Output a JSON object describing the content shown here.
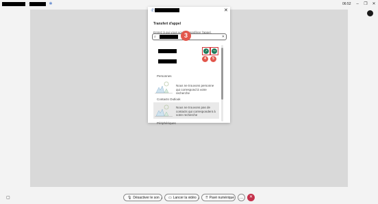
{
  "titlebar": {
    "time": "06:52",
    "pin_icon": "pin-icon",
    "minimize": "–",
    "restore": "❐",
    "close": "✕"
  },
  "dialog": {
    "title": "Transfert d'appel",
    "close": "✕",
    "subtitle": "Entrez à qui vous voulez transférer l'appel.",
    "search_icon": "⌕",
    "search_clear": "✕",
    "callout_search": "3",
    "callout_a": "4",
    "callout_b": "5",
    "sections": [
      {
        "label": "Personnes",
        "empty_text": "Nous ne trouvons personne qui correspond à votre recherche"
      },
      {
        "label": "Contacts Outlook",
        "empty_text": "Nous ne trouvons pas de contacts qui correspondent à votre recherche"
      },
      {
        "label": "Périphériques"
      }
    ],
    "result_actions": {
      "a": "↗",
      "b": "↪"
    }
  },
  "callbar": {
    "mute": "Désactiver le son",
    "video": "Lancer la vidéo",
    "dialpad": "Pavé numérique",
    "more": "…",
    "hangup": "✕",
    "mute_icon": "🎙",
    "video_icon": "▭",
    "dialpad_icon": "⠿"
  },
  "colors": {
    "accent_green": "#1f7a5a",
    "callout_red": "#e2574c",
    "hangup_red": "#c4314b",
    "highlight_box": "#d13438"
  }
}
